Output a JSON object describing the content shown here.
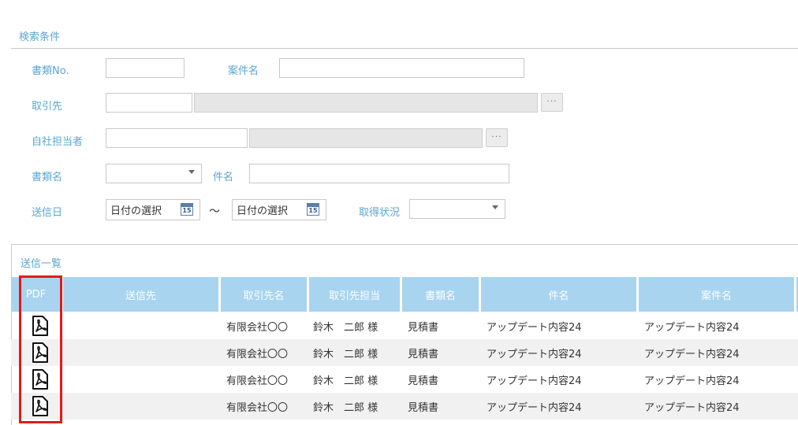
{
  "search": {
    "title": "検索条件",
    "doc_no_label": "書類No.",
    "case_name_label": "案件名",
    "client_label": "取引先",
    "staff_label": "自社担当者",
    "doc_name_label": "書類名",
    "subject_label": "件名",
    "send_date_label": "送信日",
    "date_from": "日付の選択",
    "date_to": "日付の選択",
    "date_separator": "〜",
    "calendar_day": "15",
    "status_label": "取得状況",
    "lookup_button": "···"
  },
  "list": {
    "title": "送信一覧",
    "columns": [
      "PDF",
      "送信先",
      "取引先名",
      "取引先担当",
      "書類名",
      "件名",
      "案件名"
    ],
    "rows": [
      {
        "client": "有限会社〇〇",
        "contact": "鈴木　二郎 様",
        "doc": "見積書",
        "subject": "アップデート内容24",
        "case": "アップデート内容24"
      },
      {
        "client": "有限会社〇〇",
        "contact": "鈴木　二郎 様",
        "doc": "見積書",
        "subject": "アップデート内容24",
        "case": "アップデート内容24"
      },
      {
        "client": "有限会社〇〇",
        "contact": "鈴木　二郎 様",
        "doc": "見積書",
        "subject": "アップデート内容24",
        "case": "アップデート内容24"
      },
      {
        "client": "有限会社〇〇",
        "contact": "鈴木　二郎 様",
        "doc": "見積書",
        "subject": "アップデート内容24",
        "case": "アップデート内容24"
      }
    ]
  },
  "colors": {
    "accent": "#5ba6cf",
    "header_bg": "#a8d4f0",
    "highlight": "#e01b1b"
  }
}
